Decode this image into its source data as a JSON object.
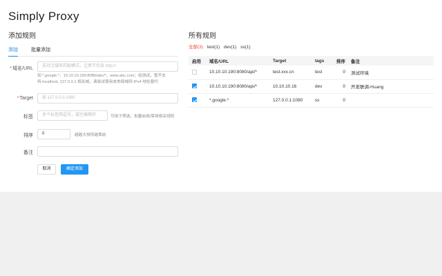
{
  "app_title": "Simply Proxy",
  "add": {
    "section_title": "添加规则",
    "tabs": [
      {
        "label": "添加",
        "active": true
      },
      {
        "label": "批量添加",
        "active": false
      }
    ],
    "url": {
      "label": "域名/URL",
      "placeholder": "支持泛域名匹配模式，注意不包含 http://",
      "hint_line1": "如 *.google.*，10.10.10.190:8080/abc/*，www.abc.com；经测试，暂不支",
      "hint_line2": "持 localhost, 127.0.0.1 相关域，请尝试使用本地局域网 IPv4 地址替代"
    },
    "target": {
      "label": "Target",
      "placeholder": "如 127.0.0.1:1080"
    },
    "tags": {
      "label": "标签",
      "placeholder": "多个标签用逗号，或空格隔开",
      "hint": "可用于筛选、批量启用/禁用相关规则"
    },
    "sort": {
      "label": "排序",
      "value": "0",
      "hint": "越越大排序越靠前"
    },
    "note": {
      "label": "备注",
      "value": ""
    },
    "cancel_label": "取消",
    "confirm_label": "确定添加"
  },
  "rules": {
    "section_title": "所有规则",
    "filters": [
      {
        "label": "全部(3)",
        "active": true
      },
      {
        "label": "test(1)",
        "active": false
      },
      {
        "label": "dev(1)",
        "active": false
      },
      {
        "label": "ss(1)",
        "active": false
      }
    ],
    "columns": [
      "启用",
      "域名/URL",
      "Target",
      "tags",
      "排序",
      "备注"
    ],
    "rows": [
      {
        "enabled": false,
        "url": "10.10.10.190:8080/api/*",
        "target": "test.xxx.cn",
        "tags": "test",
        "sort": "0",
        "note": "测试环境"
      },
      {
        "enabled": true,
        "url": "10.10.10.190:8080/api/*",
        "target": "10.10.10.16",
        "tags": "dev",
        "sort": "0",
        "note": "开发联调-Huang"
      },
      {
        "enabled": true,
        "url": "*.google.*",
        "target": "127.0.0.1:1080",
        "tags": "ss",
        "sort": "0",
        "note": ""
      }
    ]
  },
  "colors": {
    "primary": "#2196f3",
    "required": "#f44336",
    "footer_bg": "#f0f0f0"
  }
}
